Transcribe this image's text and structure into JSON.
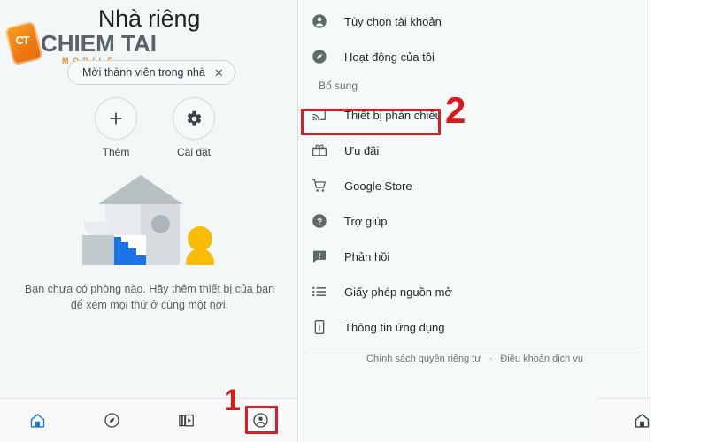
{
  "left_pane": {
    "title": "Nhà riêng",
    "watermark": {
      "badge_text": "CT",
      "name": "CHIEM TAI",
      "sub": "MOBILE",
      "badge_color": "#ef7c14",
      "name_color": "#5a6168",
      "sub_color": "#ef8b22"
    },
    "invite_chip": {
      "label": "Mời thành viên trong nhà",
      "close_icon": "close-icon",
      "close_glyph": "✕"
    },
    "actions": [
      {
        "label": "Thêm",
        "icon": "plus-icon"
      },
      {
        "label": "Cài đặt",
        "icon": "gear-icon"
      }
    ],
    "illustration_name": "empty-home-illustration",
    "empty_text": "Bạn chưa có phòng nào. Hãy thêm thiết bị của bạn để xem mọi thứ ở cùng một nơi.",
    "bottom_nav": [
      {
        "name": "home",
        "icon": "home-icon",
        "active": true
      },
      {
        "name": "explore",
        "icon": "compass-icon",
        "active": false
      },
      {
        "name": "media",
        "icon": "media-icon",
        "active": false
      },
      {
        "name": "account",
        "icon": "account-icon",
        "active": false
      }
    ]
  },
  "right_pane": {
    "menu_top": [
      {
        "label": "Tùy chọn tài khoản",
        "icon": "account-circle-icon"
      },
      {
        "label": "Hoạt động của tôi",
        "icon": "compass-filled-icon"
      }
    ],
    "section_label": "Bổ sung",
    "menu_bottom": [
      {
        "label": "Thiết bị phản chiếu",
        "icon": "cast-icon",
        "highlighted": true
      },
      {
        "label": "Ưu đãi",
        "icon": "gift-icon",
        "highlighted": false
      },
      {
        "label": "Google Store",
        "icon": "cart-icon",
        "highlighted": false
      },
      {
        "label": "Trợ giúp",
        "icon": "help-icon",
        "highlighted": false
      },
      {
        "label": "Phản hồi",
        "icon": "feedback-icon",
        "highlighted": false
      },
      {
        "label": "Giấy phép nguồn mở",
        "icon": "list-icon",
        "highlighted": false
      },
      {
        "label": "Thông tin ứng dụng",
        "icon": "app-info-icon",
        "highlighted": false
      }
    ],
    "legal": {
      "privacy": "Chính sách quyền riêng tư",
      "separator": "·",
      "terms": "Điều khoản dịch vụ"
    },
    "bottom_nav": [
      {
        "name": "home",
        "icon": "home-icon",
        "active": false
      },
      {
        "name": "explore",
        "icon": "compass-icon",
        "active": false
      },
      {
        "name": "media",
        "icon": "media-icon",
        "active": false
      },
      {
        "name": "account",
        "icon": "account-icon",
        "active": true
      }
    ]
  },
  "annotations": {
    "step_one": "1",
    "step_two": "2",
    "color": "#d81b1b"
  }
}
